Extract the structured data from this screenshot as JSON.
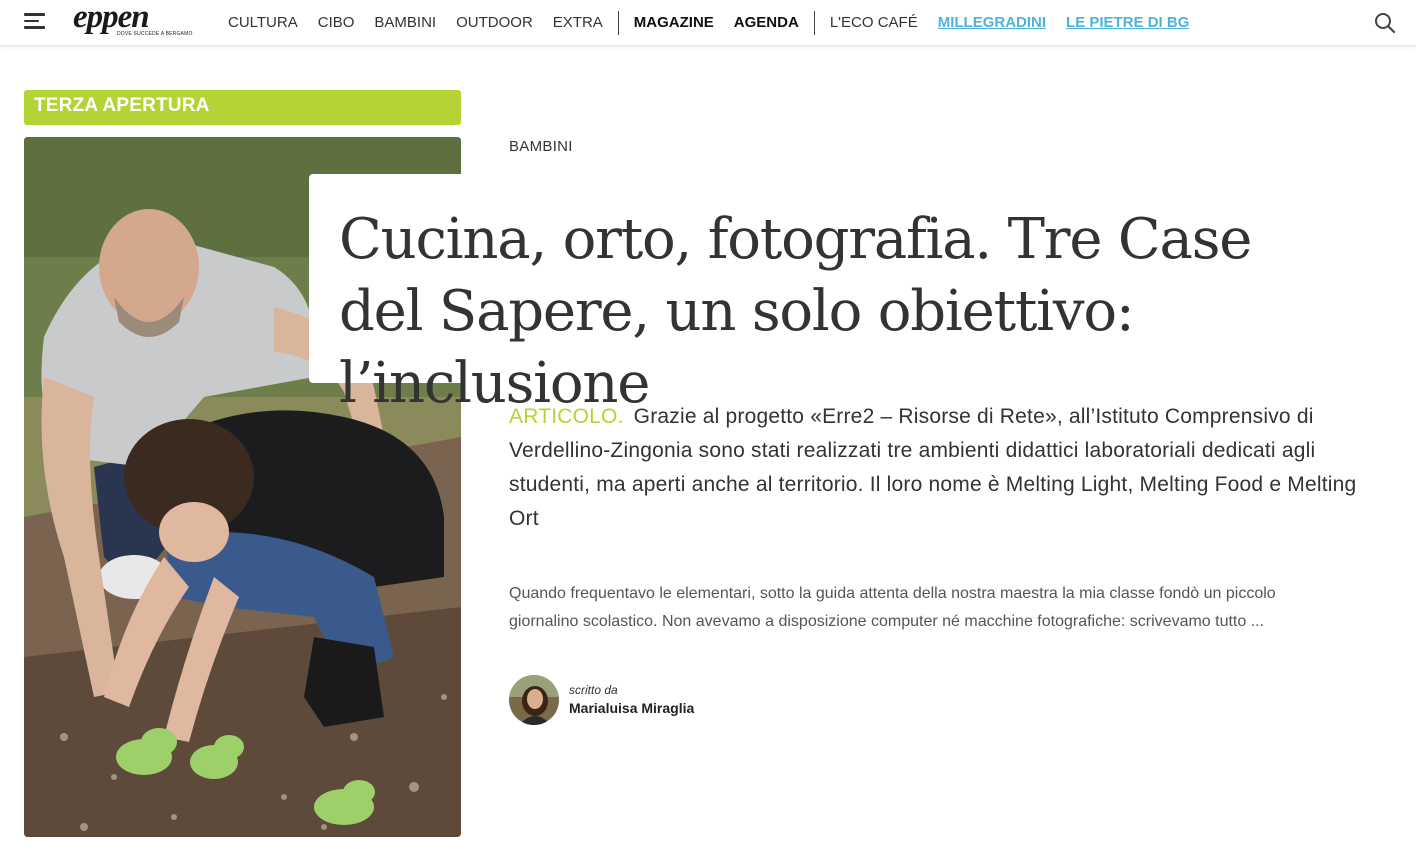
{
  "header": {
    "logo_text": "eppen",
    "logo_tagline": "DOVE SUCCEDE A BERGAMO",
    "nav_primary": [
      "CULTURA",
      "CIBO",
      "BAMBINI",
      "OUTDOOR",
      "EXTRA"
    ],
    "nav_secondary": [
      "MAGAZINE",
      "AGENDA"
    ],
    "nav_tertiary": [
      "L'ECO CAFÉ"
    ],
    "nav_links": [
      "MILLEGRADINI",
      "LE PIETRE DI BG"
    ],
    "menu_icon": "hamburger-menu-icon",
    "search_icon": "search-icon"
  },
  "section": {
    "label": "TERZA APERTURA",
    "color": "#b4d334"
  },
  "article": {
    "category": "BAMBINI",
    "headline": "Cucina, orto, fotografia. Tre Case del Sapere, un solo obiettivo: l’inclusione",
    "kind": "ARTICOLO.",
    "summary": "Grazie al progetto «Erre2 – Risorse di Rete», all’Istituto Comprensivo di Verdellino-Zingonia sono stati realizzati tre ambienti didattici laboratoriali dedicati agli studenti, ma aperti anche al territorio. Il loro nome è Melting Light, Melting Food e Melting Ort",
    "excerpt": "Quando frequentavo le elementari, sotto la guida attenta della nostra maestra la mia classe fondò un piccolo giornalino scolastico. Non avevamo a disposizione computer né macchine fotografiche: scrivevamo tutto ...",
    "written_by": "scritto da",
    "author": "Marialuisa Miraglia"
  },
  "colors": {
    "accent_green": "#b4d334",
    "link_blue": "#4fb3d9",
    "text_dark": "#333333"
  }
}
